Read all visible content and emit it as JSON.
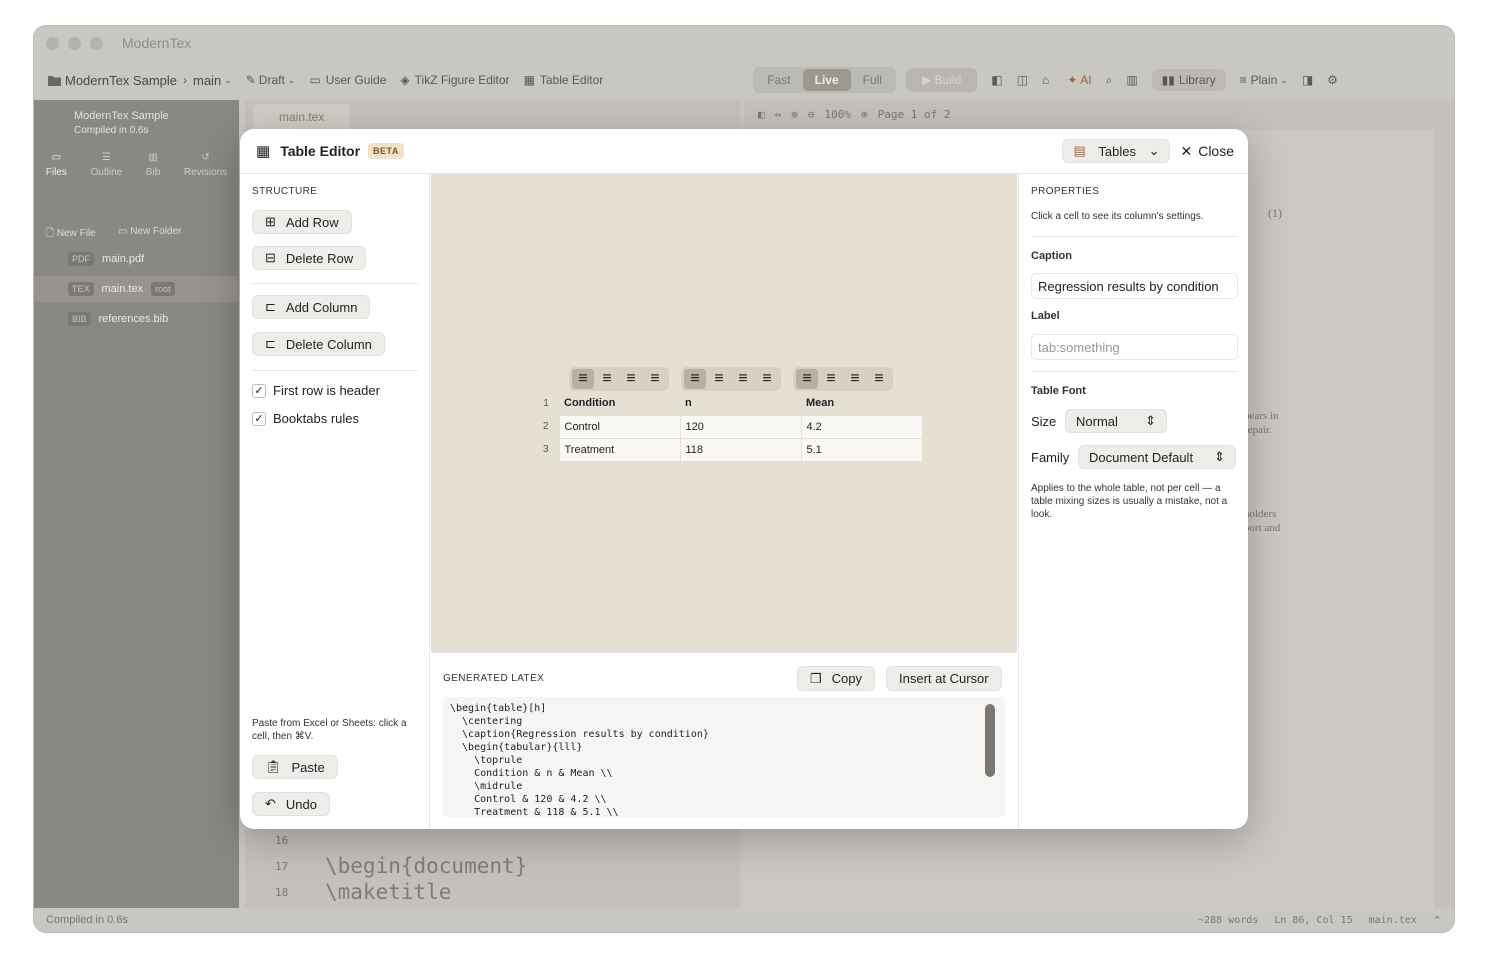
{
  "app": {
    "title": "ModernTex"
  },
  "toolbar": {
    "project": "ModernTex Sample",
    "branch": "main",
    "status": "Draft",
    "user_guide": "User Guide",
    "tikz": "TikZ Figure Editor",
    "table_editor": "Table Editor",
    "modes": [
      "Fast",
      "Live",
      "Full"
    ],
    "active_mode": "Live",
    "build": "Build",
    "ai": "AI",
    "library": "Library",
    "plain": "Plain"
  },
  "sidebar": {
    "project": "ModernTex Sample",
    "compiled": "Compiled in 0.6s",
    "tabs": [
      "Files",
      "Outline",
      "Bib",
      "Revisions"
    ],
    "new_file": "New File",
    "new_folder": "New Folder",
    "files": [
      {
        "tag": "PDF",
        "name": "main.pdf",
        "badge": ""
      },
      {
        "tag": "TEX",
        "name": "main.tex",
        "badge": "root"
      },
      {
        "tag": "BIB",
        "name": "references.bib",
        "badge": ""
      }
    ]
  },
  "editor": {
    "tab": "main.tex",
    "lines": [
      {
        "num": "16",
        "text": ""
      },
      {
        "num": "17",
        "text": "\\begin{document}"
      },
      {
        "num": "18",
        "text": "\\maketitle"
      }
    ]
  },
  "pdf": {
    "zoom": "100%",
    "page": "Page 1 of 2",
    "eq_num": "(1)",
    "frag1": "bears in",
    "frag2": "repair.",
    "frag3": "holders",
    "frag4": "port and"
  },
  "status": {
    "compiled": "Compiled in 0.6s",
    "words": "~288 words",
    "position": "Ln 86, Col 15",
    "file": "main.tex"
  },
  "modal": {
    "title": "Table Editor",
    "beta": "BETA",
    "tables_select": "Tables",
    "close": "Close",
    "structure": {
      "heading": "STRUCTURE",
      "add_row": "Add Row",
      "delete_row": "Delete Row",
      "add_column": "Add Column",
      "delete_column": "Delete Column",
      "first_row_header": "First row is header",
      "booktabs": "Booktabs rules",
      "paste_hint": "Paste from Excel or Sheets: click a cell, then ⌘V.",
      "paste": "Paste",
      "undo": "Undo"
    },
    "table": {
      "rows": [
        {
          "num": "1",
          "cells": [
            "Condition",
            "n",
            "Mean"
          ]
        },
        {
          "num": "2",
          "cells": [
            "Control",
            "120",
            "4.2"
          ]
        },
        {
          "num": "3",
          "cells": [
            "Treatment",
            "118",
            "5.1"
          ]
        }
      ]
    },
    "latex": {
      "heading": "GENERATED LATEX",
      "copy": "Copy",
      "insert": "Insert at Cursor",
      "code": "\\begin{table}[h]\n  \\centering\n  \\caption{Regression results by condition}\n  \\begin{tabular}{lll}\n    \\toprule\n    Condition & n & Mean \\\\\n    \\midrule\n    Control & 120 & 4.2 \\\\\n    Treatment & 118 & 5.1 \\\\"
    },
    "properties": {
      "heading": "PROPERTIES",
      "hint": "Click a cell to see its column's settings.",
      "caption_label": "Caption",
      "caption_value": "Regression results by condition",
      "label_label": "Label",
      "label_placeholder": "tab:something",
      "font_heading": "Table Font",
      "size_label": "Size",
      "size_value": "Normal",
      "family_label": "Family",
      "family_value": "Document Default",
      "note": "Applies to the whole table, not per cell — a table mixing sizes is usually a mistake, not a look."
    }
  }
}
